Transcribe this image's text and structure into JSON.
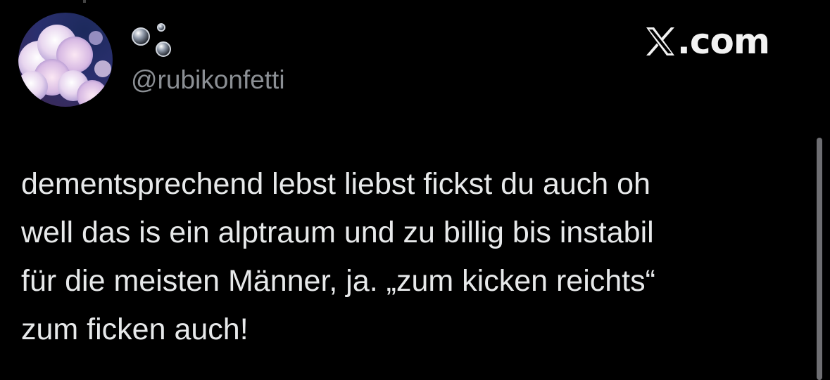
{
  "tweet": {
    "author": {
      "display_name_icon": "bubbles-emoji",
      "handle": "@rubikonfetti",
      "avatar": "cloud-sky-avatar"
    },
    "brand": {
      "logo_icon": "x-logo-icon",
      "domain": ".com"
    },
    "text": "dementsprechend lebst liebst fickst du auch oh\nwell das is ein alptraum und zu billig bis instabil\nfür die meisten Männer, ja. „zum kicken reichts“\nzum ficken auch!"
  },
  "colors": {
    "background": "#000000",
    "text": "#e7e9ea",
    "handle": "#8b8f94",
    "scrollbar": "#6e6e72"
  }
}
